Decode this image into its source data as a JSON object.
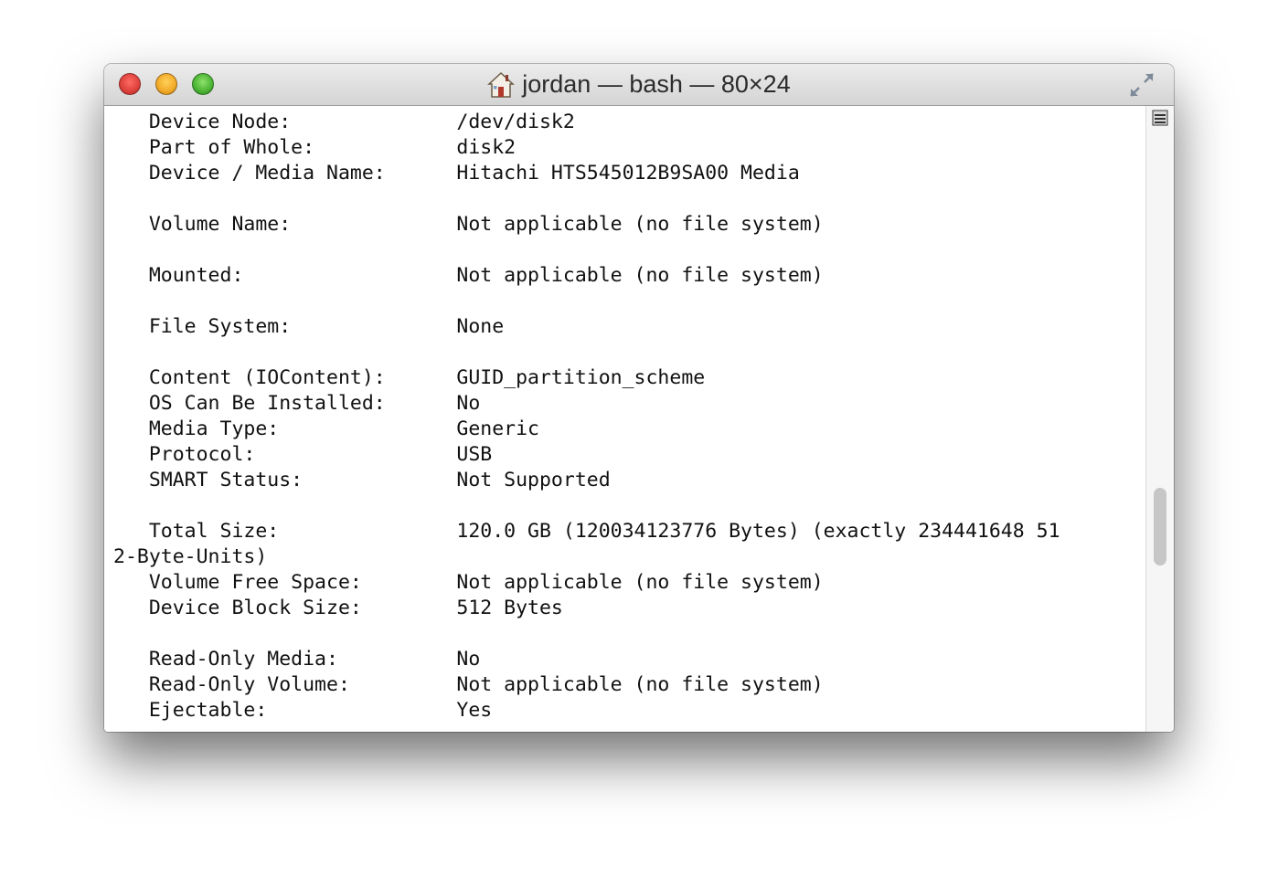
{
  "window": {
    "title": "jordan — bash — 80×24",
    "title_icon": "home-icon"
  },
  "terminal": {
    "lines": [
      "   Device Node:              /dev/disk2",
      "   Part of Whole:            disk2",
      "   Device / Media Name:      Hitachi HTS545012B9SA00 Media",
      "",
      "   Volume Name:              Not applicable (no file system)",
      "",
      "   Mounted:                  Not applicable (no file system)",
      "",
      "   File System:              None",
      "",
      "   Content (IOContent):      GUID_partition_scheme",
      "   OS Can Be Installed:      No",
      "   Media Type:               Generic",
      "   Protocol:                 USB",
      "   SMART Status:             Not Supported",
      "",
      "   Total Size:               120.0 GB (120034123776 Bytes) (exactly 234441648 51",
      "2-Byte-Units)",
      "   Volume Free Space:        Not applicable (no file system)",
      "   Device Block Size:        512 Bytes",
      "",
      "   Read-Only Media:          No",
      "   Read-Only Volume:         Not applicable (no file system)",
      "   Ejectable:                Yes"
    ]
  },
  "scrollbar": {
    "position_fraction": 0.68
  },
  "colors": {
    "close": "#e0443e",
    "minimize": "#f3ad2b",
    "zoom": "#4fb737"
  }
}
